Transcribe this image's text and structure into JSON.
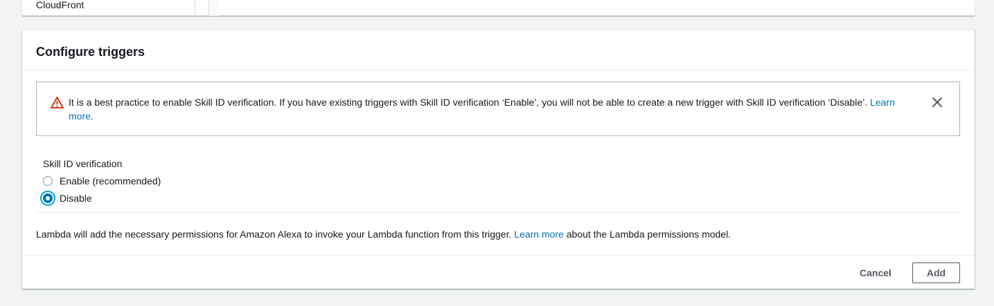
{
  "top_panel": {
    "item_label": "CloudFront"
  },
  "panel": {
    "title": "Configure triggers",
    "alert": {
      "icon": "warning-icon",
      "text": "It is a best practice to enable Skill ID verification. If you have existing triggers with Skill ID verification ‘Enable’, you will not be able to create a new trigger with Skill ID verification ‘Disable’.",
      "link_text_1": "Learn",
      "link_text_2": "more",
      "trailing": ".",
      "close_icon": "close-icon"
    },
    "skill_verification": {
      "label": "Skill ID verification",
      "options": [
        {
          "label": "Enable (recommended)",
          "selected": false
        },
        {
          "label": "Disable",
          "selected": true
        }
      ]
    },
    "info": {
      "text_before": "Lambda will add the necessary permissions for Amazon Alexa to invoke your Lambda function from this trigger. ",
      "link": "Learn more",
      "text_after": " about the Lambda permissions model."
    },
    "footer": {
      "cancel_label": "Cancel",
      "add_label": "Add"
    }
  },
  "colors": {
    "background": "#f2f3f3",
    "link": "#0073bb",
    "warning": "#d13212",
    "radio_selected": "#0073bb",
    "radio_focus_ring": "#00a1c9"
  }
}
